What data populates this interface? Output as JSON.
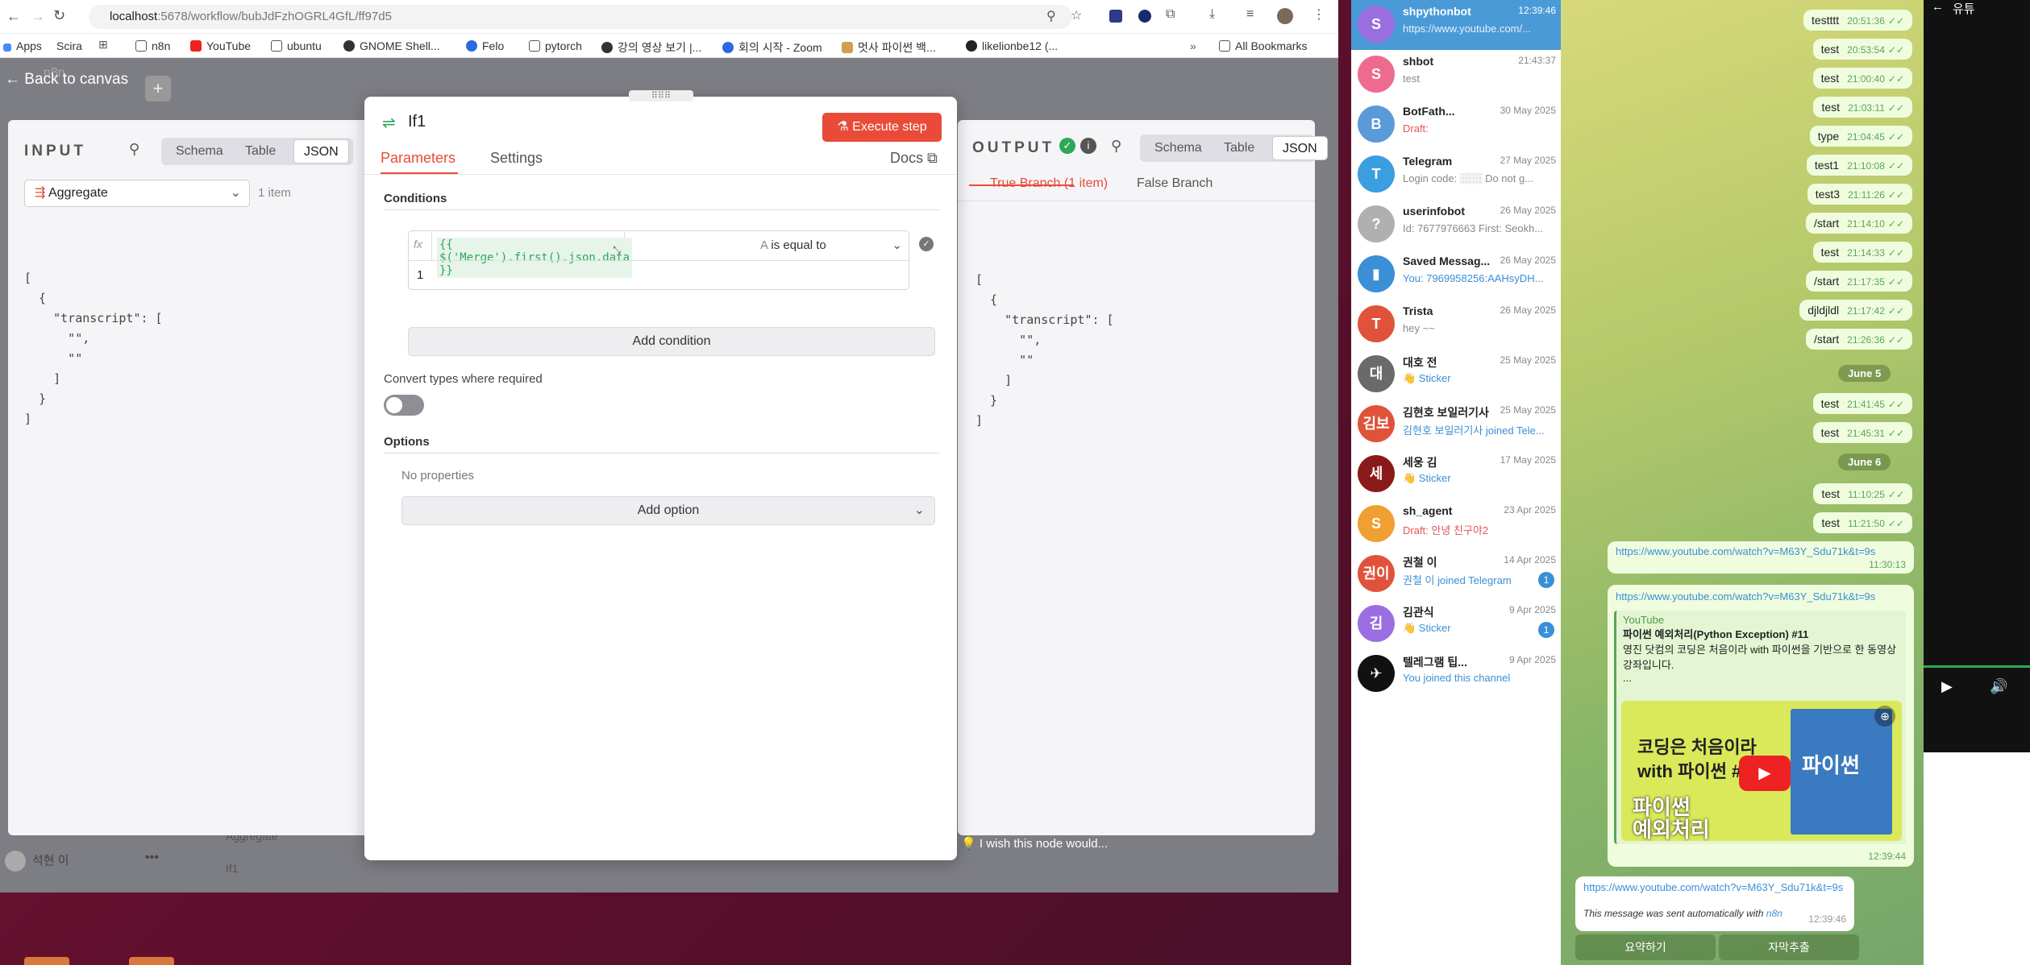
{
  "browser": {
    "url_host": "localhost",
    "url_rest": ":5678/workflow/bubJdFzhOGRL4GfL/ff97d5",
    "bookmarks": [
      "Apps",
      "Scira",
      "n8n",
      "YouTube",
      "ubuntu",
      "GNOME Shell...",
      "Felo",
      "pytorch",
      "강의 영상 보기 |...",
      "회의 시작 - Zoom",
      "멋사 파이썬 백...",
      "likelionbe12 (...",
      "All Bookmarks"
    ]
  },
  "n8n": {
    "back": "Back to canvas",
    "bg_title": "n8n",
    "bg_user": "석현 이",
    "bg_node1": "Aggregate",
    "bg_node2": "If1",
    "input": {
      "title": "INPUT",
      "tabs": [
        "Schema",
        "Table",
        "JSON"
      ],
      "node": "Aggregate",
      "count": "1 item"
    },
    "json_lines": [
      "[",
      "  {",
      "    \"transcript\": [",
      "      \"\",",
      "      \"\"",
      "    ]",
      "  }",
      "]"
    ],
    "output": {
      "title": "OUTPUT",
      "tabs": [
        "Schema",
        "Table",
        "JSON"
      ],
      "true_branch": "True Branch (1 item)",
      "false_branch": "False Branch"
    },
    "modal": {
      "title": "If1",
      "execute": "Execute step",
      "tab_params": "Parameters",
      "tab_settings": "Settings",
      "docs": "Docs",
      "conditions": "Conditions",
      "fx": "fx",
      "expr": "{{ $('Merge').first().json.data }}",
      "operator": "is equal to",
      "value": "1",
      "add_condition": "Add condition",
      "convert": "Convert types where required",
      "options": "Options",
      "no_props": "No properties",
      "add_option": "Add option"
    },
    "wish": "I wish this node would..."
  },
  "telegram": {
    "chats": [
      {
        "name": "shpythonbot",
        "date": "12:39:46",
        "msg": "https://www.youtube.com/...",
        "avatar": "S",
        "color": "#9a6ee0",
        "active": true
      },
      {
        "name": "shbot",
        "date": "21:43:37",
        "msg": "test",
        "avatar": "S",
        "color": "#ee6b8f"
      },
      {
        "name": "BotFath...",
        "date": "30 May 2025",
        "msg": "Draft:",
        "avatar": "B",
        "color": "#5a9ad8"
      },
      {
        "name": "Telegram",
        "date": "27 May 2025",
        "msg": "Login code: ░░░ Do not g...",
        "avatar": "T",
        "color": "#3a9ee0"
      },
      {
        "name": "userinfobot",
        "date": "26 May 2025",
        "msg": "Id: 7677976663 First: Seokh...",
        "avatar": "?",
        "color": "#b0b0b0"
      },
      {
        "name": "Saved Messag...",
        "date": "26 May 2025",
        "msg": "You: 7969958256:AAHsyDH...",
        "avatar": "▮",
        "color": "#3a8fd7"
      },
      {
        "name": "Trista",
        "date": "26 May 2025",
        "msg": "hey ~~",
        "avatar": "T",
        "color": "#e0533a"
      },
      {
        "name": "대호 전",
        "date": "25 May 2025",
        "msg": "👋 Sticker",
        "avatar": "대",
        "color": "#6a6a6a"
      },
      {
        "name": "김현호 보일러기사",
        "date": "25 May 2025",
        "msg": "김현호 보일러기사 joined Tele...",
        "avatar": "김보",
        "color": "#e0533a"
      },
      {
        "name": "세웅 김",
        "date": "17 May 2025",
        "msg": "👋 Sticker",
        "avatar": "세",
        "color": "#8a1a1a"
      },
      {
        "name": "sh_agent",
        "date": "23 Apr 2025",
        "msg": "Draft: 안녕 친구야2",
        "avatar": "S",
        "color": "#f0a030"
      },
      {
        "name": "권철 이",
        "date": "14 Apr 2025",
        "msg": "권철 이 joined Telegram",
        "avatar": "권이",
        "color": "#e0533a",
        "badge": "1"
      },
      {
        "name": "김관식",
        "date": "9 Apr 2025",
        "msg": "👋 Sticker",
        "avatar": "김",
        "color": "#9a6ee0",
        "badge": "1"
      },
      {
        "name": "텔레그램 팁...",
        "date": "9 Apr 2025",
        "msg": "You joined this channel",
        "avatar": "✈",
        "color": "#111"
      }
    ],
    "messages": [
      {
        "text": "testttt",
        "time": "20:51:36"
      },
      {
        "text": "test",
        "time": "20:53:54"
      },
      {
        "text": "test",
        "time": "21:00:40"
      },
      {
        "text": "test",
        "time": "21:03:11"
      },
      {
        "text": "type",
        "time": "21:04:45"
      },
      {
        "text": "test1",
        "time": "21:10:08"
      },
      {
        "text": "test3",
        "time": "21:11:26"
      },
      {
        "text": "/start",
        "time": "21:14:10"
      },
      {
        "text": "test",
        "time": "21:14:33"
      },
      {
        "text": "/start",
        "time": "21:17:35"
      },
      {
        "text": "djldjldl",
        "time": "21:17:42"
      },
      {
        "text": "/start",
        "time": "21:26:36"
      }
    ],
    "date1": "June 5",
    "m5": [
      {
        "text": "test",
        "time": "21:41:45"
      },
      {
        "text": "test",
        "time": "21:45:31"
      }
    ],
    "date2": "June 6",
    "m6": [
      {
        "text": "test",
        "time": "11:10:25"
      },
      {
        "text": "test",
        "time": "11:21:50"
      }
    ],
    "link1": "https://www.youtube.com/watch?v=M63Y_Sdu71k&t=9s",
    "link1_time": "11:30:13",
    "preview": {
      "site": "YouTube",
      "title": "파이썬 예외처리(Python Exception) #11",
      "desc": "영진 닷컴의 코딩은 처음이라 with 파이썬을 기반으로 한 동영상 강좌입니다.",
      "ellipsis": "...",
      "thumb1": "코딩은 처음이라",
      "thumb2": "with 파이썬 #11",
      "thumb3": "파이썬",
      "thumb4": "예외처리",
      "book": "파이썬",
      "time": "12:39:44"
    },
    "bot_link": "https://www.youtube.com/watch?v=M63Y_Sdu71k&t=9s",
    "bot_note": "This message was sent automatically with",
    "bot_n8n": "n8n",
    "bot_time": "12:39:46",
    "btn1": "요약하기",
    "btn2": "자막추출"
  },
  "right": {
    "label": "유튜"
  }
}
